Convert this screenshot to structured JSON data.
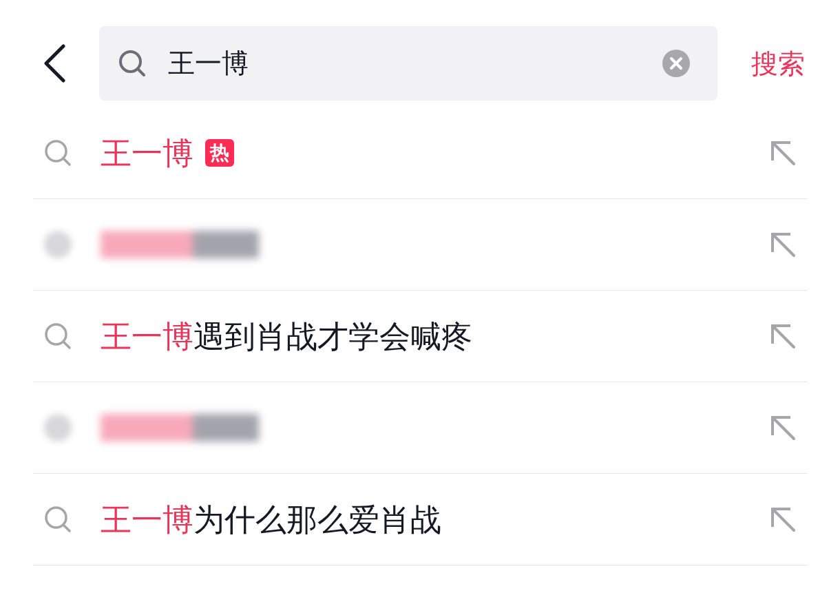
{
  "search_bar": {
    "value": "王一博",
    "search_button": "搜索"
  },
  "suggestions": [
    {
      "kind": "suggestion",
      "match": "王一博",
      "badge": "热"
    },
    {
      "kind": "blurred"
    },
    {
      "kind": "suggestion",
      "match": "王一博",
      "rest": "遇到肖战才学会喊疼"
    },
    {
      "kind": "blurred"
    },
    {
      "kind": "suggestion",
      "match": "王一博",
      "rest": "为什么那么爱肖战"
    }
  ]
}
